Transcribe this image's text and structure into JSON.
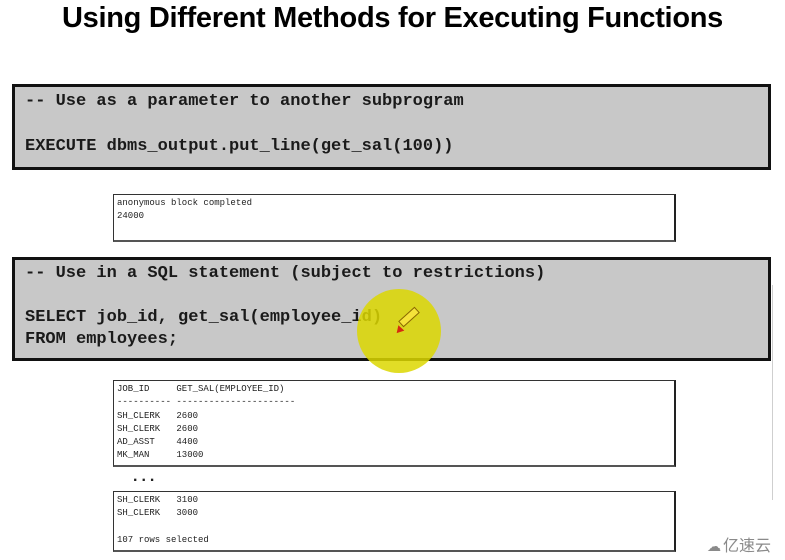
{
  "slide": {
    "title": "Using Different Methods for Executing Functions"
  },
  "section1": {
    "comment": "-- Use as a parameter to another subprogram",
    "code": "EXECUTE dbms_output.put_line(get_sal(100))",
    "output": [
      "anonymous block completed",
      "24000"
    ]
  },
  "section2": {
    "comment": "-- Use in a SQL statement (subject to restrictions)",
    "code_lines": [
      "SELECT job_id, get_sal(employee_id)",
      "FROM employees;"
    ],
    "annotation_color": "#e0141a",
    "highlight_color": "#dcd700",
    "result_header": "JOB_ID     GET_SAL(EMPLOYEE_ID)",
    "result_separator": "---------- ----------------------",
    "result_rows_top": [
      "SH_CLERK   2600",
      "SH_CLERK   2600",
      "AD_ASST    4400",
      "MK_MAN     13000"
    ],
    "ellipsis": "...",
    "result_rows_bottom": [
      "SH_CLERK   3100",
      "SH_CLERK   3000"
    ],
    "rows_selected": "107 rows selected"
  },
  "watermark": {
    "logo_icon": "cloud-icon",
    "text": "亿速云"
  }
}
